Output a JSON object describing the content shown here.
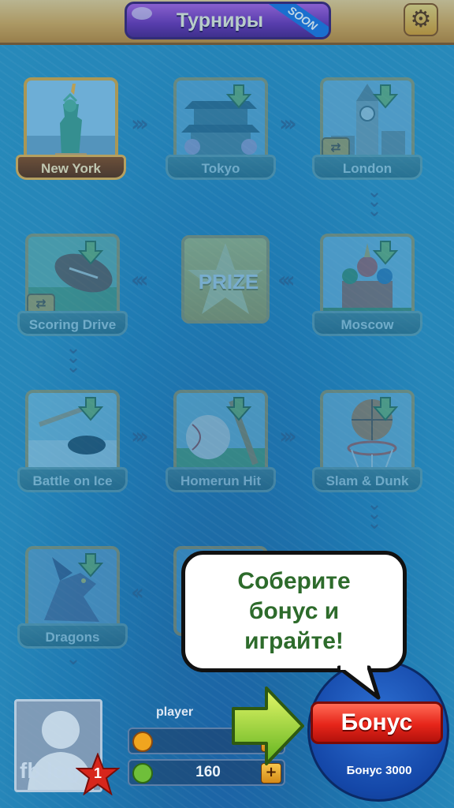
{
  "header": {
    "title": "Турниры",
    "soon_label": "SOON"
  },
  "map": {
    "tiles": [
      {
        "id": "new-york",
        "label": "New York"
      },
      {
        "id": "tokyo",
        "label": "Tokyo"
      },
      {
        "id": "london",
        "label": "London"
      },
      {
        "id": "moscow",
        "label": "Moscow"
      },
      {
        "id": "prize",
        "label": "PRIZE"
      },
      {
        "id": "scoring-drive",
        "label": "Scoring Drive"
      },
      {
        "id": "battle-on-ice",
        "label": "Battle on Ice"
      },
      {
        "id": "homerun-hit",
        "label": "Homerun Hit"
      },
      {
        "id": "slam-dunk",
        "label": "Slam & Dunk"
      },
      {
        "id": "dragons",
        "label": "Dragons"
      }
    ]
  },
  "profile": {
    "avatar_text": "fb log",
    "level": "1",
    "player_name": "player",
    "coins_value": "",
    "clovers_value": "160"
  },
  "bonus": {
    "button_label": "Бонус",
    "subtitle": "Бонус 3000",
    "speech_line1": "Соберите",
    "speech_line2": "бонус и",
    "speech_line3": "играйте!"
  },
  "colors": {
    "accent_gold": "#e0a73a",
    "bonus_red": "#e6251a",
    "speech_green": "#2d6b2b"
  }
}
